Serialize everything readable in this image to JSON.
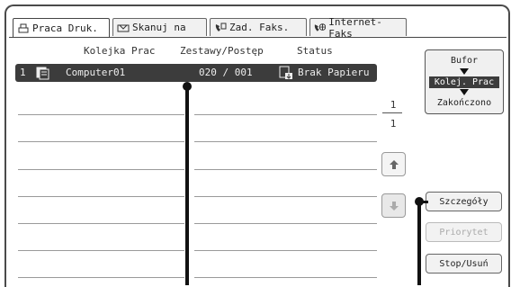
{
  "tabs": [
    {
      "label": "Praca Druk.",
      "icon": "printer-icon"
    },
    {
      "label": "Skanuj na",
      "icon": "scan-icon"
    },
    {
      "label": "Zad. Faks.",
      "icon": "fax-icon"
    },
    {
      "label": "Internet-Faks",
      "icon": "internet-fax-icon"
    }
  ],
  "columns": {
    "queue": "Kolejka Prac",
    "sets": "Zestawy/Postęp",
    "status": "Status"
  },
  "jobs": [
    {
      "num": "1",
      "name": "Computer01",
      "progress": "020 / 001",
      "status": "Brak Papieru"
    }
  ],
  "pager": {
    "current": "1",
    "total": "1"
  },
  "view_selector": {
    "top": "Bufor",
    "middle": "Kolej. Prac",
    "bottom": "Zakończono"
  },
  "buttons": {
    "details": "Szczegóły",
    "priority": "Priorytet",
    "stop": "Stop/Usuń"
  },
  "colors": {
    "selected_row": "#3c3c3c",
    "accent": "#111111"
  }
}
